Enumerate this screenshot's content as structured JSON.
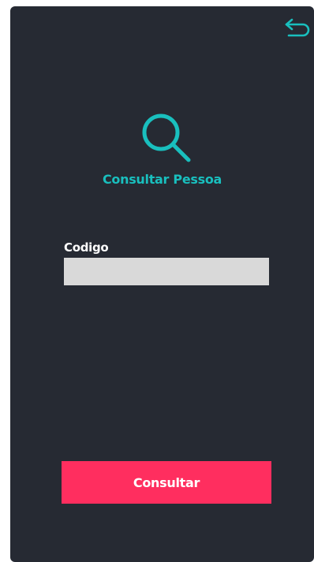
{
  "colors": {
    "background": "#262a33",
    "accent": "#19bfbe",
    "button": "#ff2e5f",
    "input_background": "#d9d9d9",
    "text": "#ffffff"
  },
  "header": {
    "back_icon": "back-arrow-icon"
  },
  "hero": {
    "icon": "search-icon",
    "title": "Consultar Pessoa"
  },
  "form": {
    "codigo_label": "Codigo",
    "codigo_value": "",
    "codigo_placeholder": ""
  },
  "actions": {
    "submit_label": "Consultar"
  }
}
